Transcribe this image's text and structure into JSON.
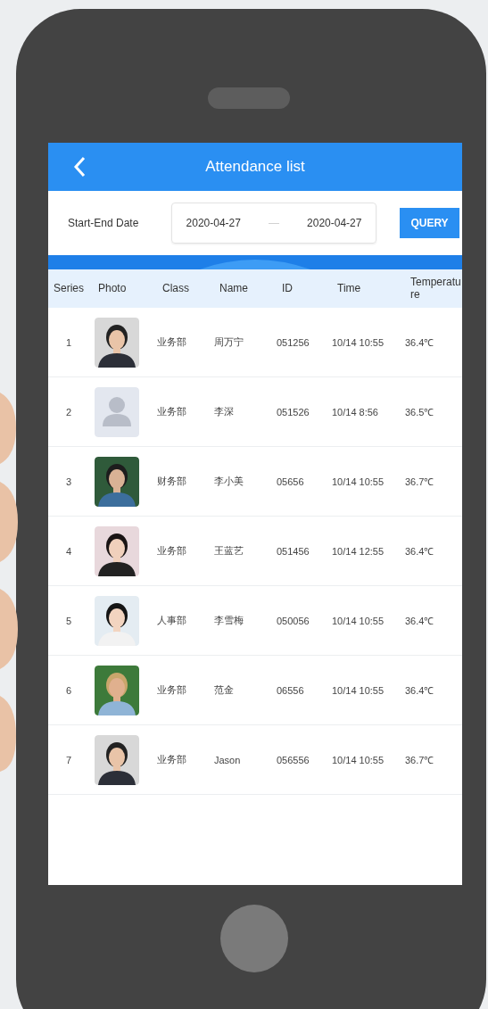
{
  "header": {
    "title": "Attendance list"
  },
  "filter": {
    "label": "Start-End Date",
    "start": "2020-04-27",
    "separator": "—",
    "end": "2020-04-27",
    "button": "QUERY"
  },
  "table": {
    "columns": [
      "Series",
      "Photo",
      "Class",
      "Name",
      "ID",
      "Time",
      "Temperature"
    ],
    "rows": [
      {
        "series": "1",
        "class": "业务部",
        "name": "周万宁",
        "id": "051256",
        "time": "10/14 10:55",
        "temperature": "36.4℃"
      },
      {
        "series": "2",
        "photo": {
          "kind": "placeholder"
        },
        "class": "业务部",
        "name": "李深",
        "id": "051526",
        "time": "10/14 8:56",
        "temperature": "36.5℃"
      },
      {
        "series": "3",
        "class": "财务部",
        "name": "李小美",
        "id": "05656",
        "time": "10/14 10:55",
        "temperature": "36.7℃"
      },
      {
        "series": "4",
        "class": "业务部",
        "name": "王蓝艺",
        "id": "051456",
        "time": "10/14 12:55",
        "temperature": "36.4℃"
      },
      {
        "series": "5",
        "class": "人事部",
        "name": "李雪梅",
        "id": "050056",
        "time": "10/14 10:55",
        "temperature": "36.4℃"
      },
      {
        "series": "6",
        "class": "业务部",
        "name": "范金",
        "id": "06556",
        "time": "10/14 10:55",
        "temperature": "36.4℃"
      },
      {
        "series": "7",
        "class": "业务部",
        "name": "Jason",
        "id": "056556",
        "time": "10/14 10:55",
        "temperature": "36.7℃"
      }
    ]
  }
}
